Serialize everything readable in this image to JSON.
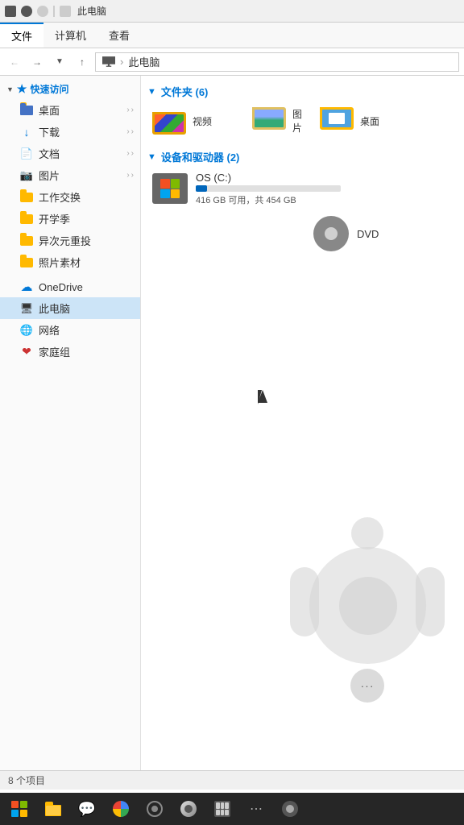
{
  "titleBar": {
    "title": "此电脑"
  },
  "ribbon": {
    "tabs": [
      {
        "label": "文件",
        "active": true
      },
      {
        "label": "计算机",
        "active": false
      },
      {
        "label": "查看",
        "active": false
      }
    ]
  },
  "addressBar": {
    "path": "此电脑",
    "separator": "›"
  },
  "sidebar": {
    "quickAccess": "快速访问",
    "items": [
      {
        "label": "桌面",
        "icon": "folder-blue"
      },
      {
        "label": "下载",
        "icon": "arrow-down"
      },
      {
        "label": "文档",
        "icon": "doc"
      },
      {
        "label": "图片",
        "icon": "image"
      },
      {
        "label": "工作交换",
        "icon": "folder"
      },
      {
        "label": "开学季",
        "icon": "folder"
      },
      {
        "label": "异次元重投",
        "icon": "folder"
      },
      {
        "label": "照片素材",
        "icon": "folder"
      }
    ],
    "oneDrive": "OneDrive",
    "thisPC": "此电脑",
    "network": "网络",
    "homeGroup": "家庭组"
  },
  "content": {
    "foldersSection": {
      "label": "文件夹 (6)",
      "items": [
        {
          "name": "视频",
          "type": "video-folder"
        },
        {
          "name": "图片",
          "type": "image-folder"
        },
        {
          "name": "桌面",
          "type": "desktop-folder"
        }
      ]
    },
    "devicesSection": {
      "label": "设备和驱动器 (2)",
      "drives": [
        {
          "name": "OS (C:)",
          "type": "hdd",
          "space": "416 GB 可用，共 454 GB",
          "progressPercent": 8
        }
      ],
      "dvd": {
        "name": "DVD",
        "type": "dvd"
      }
    }
  },
  "statusBar": {
    "itemCount": "8 个项目"
  },
  "taskbar": {
    "buttons": [
      {
        "label": "⊞",
        "name": "start"
      },
      {
        "label": "🗂",
        "name": "file-explorer"
      },
      {
        "label": "💬",
        "name": "wechat"
      },
      {
        "label": "◎",
        "name": "browser1"
      },
      {
        "label": "●",
        "name": "browser2"
      },
      {
        "label": "🌀",
        "name": "vpn"
      },
      {
        "label": "☰",
        "name": "menu"
      },
      {
        "label": "⋯",
        "name": "more"
      },
      {
        "label": "◑",
        "name": "system"
      }
    ]
  },
  "radialMenu": {
    "dots": "···"
  }
}
